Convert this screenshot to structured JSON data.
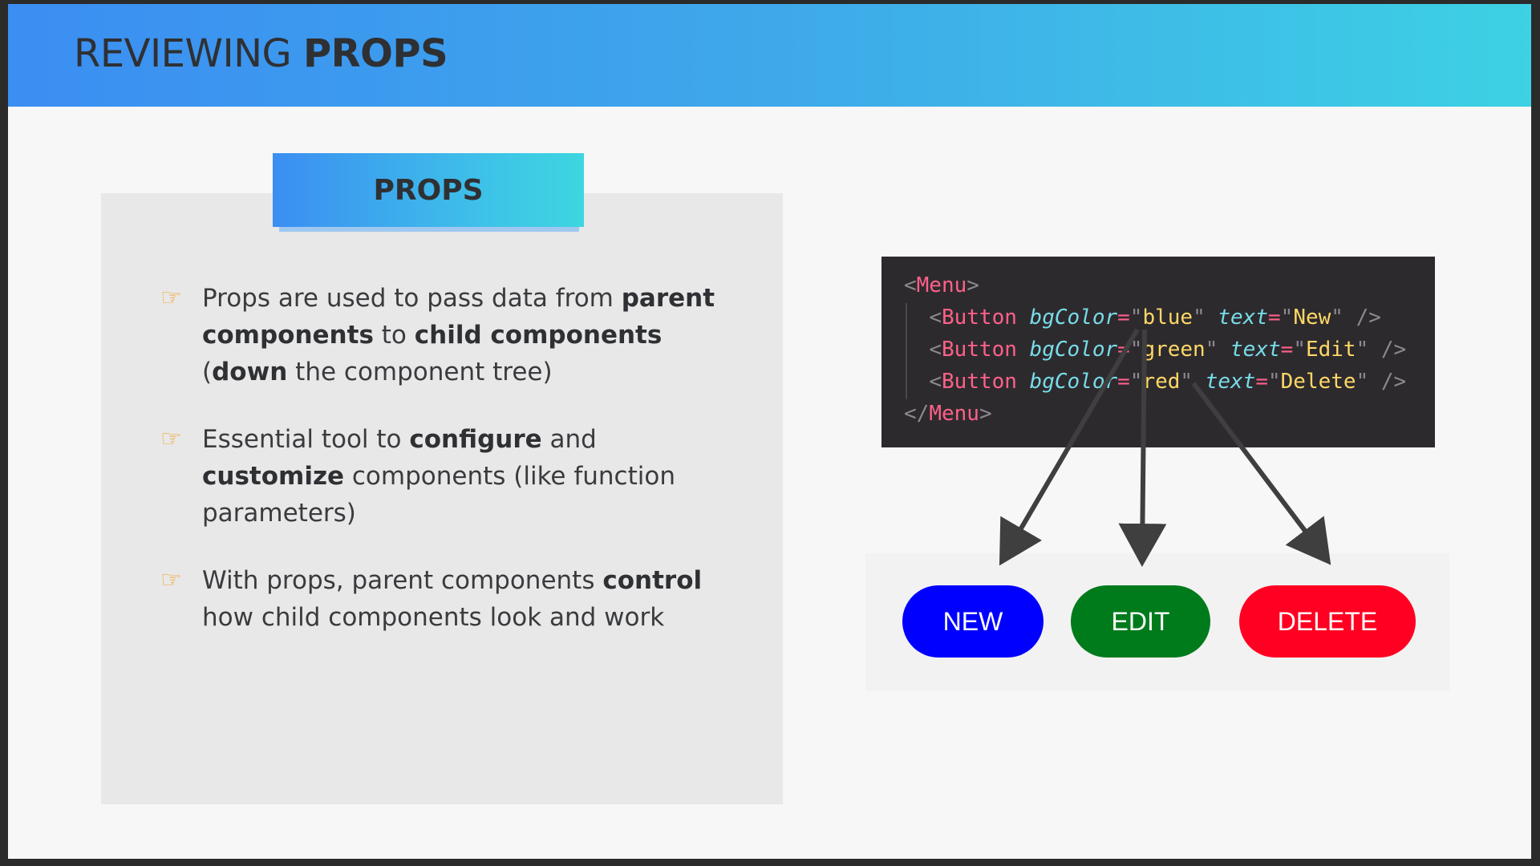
{
  "header": {
    "title_light": "REVIEWING ",
    "title_bold": "PROPS"
  },
  "panel": {
    "tag_label": "PROPS",
    "bullets": [
      {
        "icon": "pointing-hand-icon",
        "parts": [
          {
            "text": "Props are used to pass data from ",
            "bold": false
          },
          {
            "text": "parent components",
            "bold": true
          },
          {
            "text": " to ",
            "bold": false
          },
          {
            "text": "child components",
            "bold": true
          },
          {
            "text": " (",
            "bold": false
          },
          {
            "text": "down",
            "bold": true
          },
          {
            "text": " the component tree)",
            "bold": false
          }
        ]
      },
      {
        "icon": "pointing-hand-icon",
        "parts": [
          {
            "text": "Essential tool to ",
            "bold": false
          },
          {
            "text": "configure",
            "bold": true
          },
          {
            "text": " and ",
            "bold": false
          },
          {
            "text": "customize",
            "bold": true
          },
          {
            "text": " components (like function parameters)",
            "bold": false
          }
        ]
      },
      {
        "icon": "pointing-hand-icon",
        "parts": [
          {
            "text": "With props, parent components ",
            "bold": false
          },
          {
            "text": "control",
            "bold": true
          },
          {
            "text": " how child components look and work",
            "bold": false
          }
        ]
      }
    ]
  },
  "code": {
    "open_tag": "Menu",
    "close_tag": "Menu",
    "component": "Button",
    "attr_color": "bgColor",
    "attr_text": "text",
    "lines": [
      {
        "color": "blue",
        "text": "New"
      },
      {
        "color": "green",
        "text": "Edit"
      },
      {
        "color": "red",
        "text": "Delete"
      }
    ]
  },
  "buttons": {
    "new_label": "NEW",
    "edit_label": "EDIT",
    "delete_label": "DELETE",
    "colors": {
      "new": "#0000ff",
      "edit": "#007b1c",
      "delete": "#ff0022"
    }
  },
  "colors": {
    "header_gradient_start": "#3b8ef2",
    "header_gradient_end": "#3dd1e4",
    "code_bg": "#2d2a2e",
    "arrow": "#3f3f3f"
  }
}
